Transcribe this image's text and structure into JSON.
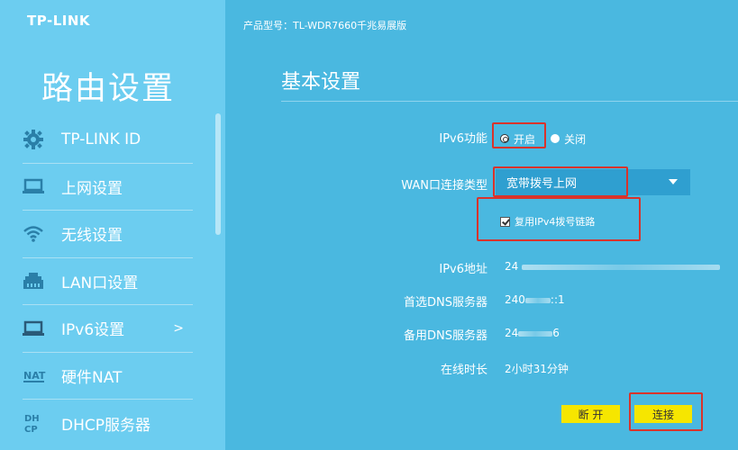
{
  "brand": {
    "logo": "TP-LINK"
  },
  "sidebar": {
    "title": "路由设置",
    "items": [
      {
        "label": "TP-LINK ID",
        "icon": "gear-icon"
      },
      {
        "label": "上网设置",
        "icon": "laptop-icon"
      },
      {
        "label": "无线设置",
        "icon": "wifi-icon"
      },
      {
        "label": "LAN口设置",
        "icon": "lan-port-icon"
      },
      {
        "label": "IPv6设置",
        "icon": "laptop-icon",
        "active": true,
        "arrow": ">"
      },
      {
        "label": "硬件NAT",
        "icon": "nat-icon",
        "icon_text": "NAT"
      },
      {
        "label": "DHCP服务器",
        "icon": "dhcp-icon",
        "icon_text": "DH CP"
      }
    ]
  },
  "header": {
    "model": "产品型号：TL-WDR7660千兆易展版"
  },
  "main": {
    "title": "基本设置",
    "ipv6_function": {
      "label": "IPv6功能",
      "options": [
        {
          "label": "开启",
          "checked": true
        },
        {
          "label": "关闭",
          "checked": false
        }
      ]
    },
    "wan_type": {
      "label": "WAN口连接类型",
      "value": "宽带拨号上网"
    },
    "reuse_ipv4": {
      "label": "复用IPv4拨号链路",
      "checked": true
    },
    "ipv6_address": {
      "label": "IPv6地址",
      "value_prefix": "24"
    },
    "primary_dns": {
      "label": "首选DNS服务器",
      "value_prefix": "240",
      "value_suffix": "::1"
    },
    "secondary_dns": {
      "label": "备用DNS服务器",
      "value_prefix": "24",
      "value_suffix": "6"
    },
    "online_time": {
      "label": "在线时长",
      "value": "2小时31分钟"
    },
    "buttons": {
      "disconnect": "断 开",
      "connect": "连接"
    }
  },
  "colors": {
    "sidebar_bg": "#6ccdf0",
    "main_bg": "#4ab8e0",
    "select_bg": "#2f9fd0",
    "button_bg": "#f6e600",
    "highlight": "#d9332b"
  }
}
